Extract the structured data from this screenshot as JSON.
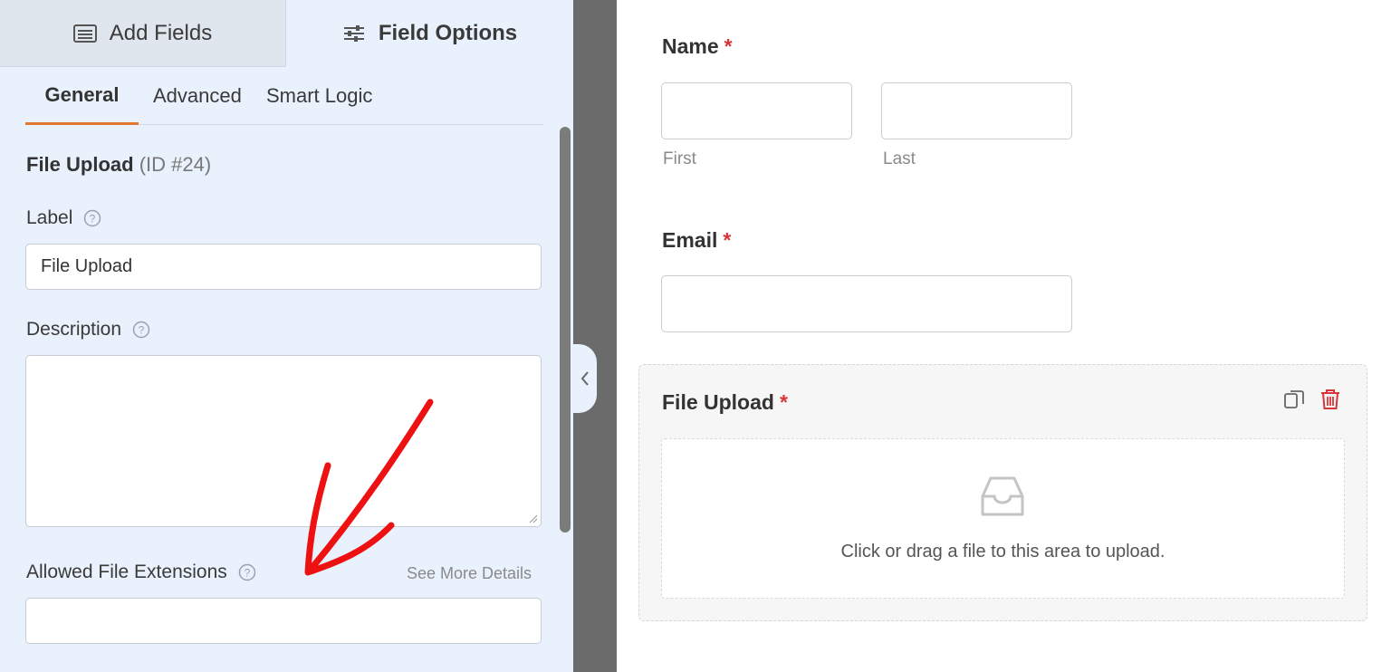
{
  "top_tabs": {
    "add_fields": "Add Fields",
    "field_options": "Field Options"
  },
  "sub_tabs": {
    "general": "General",
    "advanced": "Advanced",
    "smart_logic": "Smart Logic"
  },
  "field_options": {
    "field_name": "File Upload",
    "field_id": "(ID #24)",
    "label_label": "Label",
    "label_value": "File Upload",
    "description_label": "Description",
    "description_value": "",
    "extensions_label": "Allowed File Extensions",
    "extensions_value": "",
    "see_more": "See More Details"
  },
  "preview": {
    "name_label": "Name",
    "required_mark": "*",
    "first_sublabel": "First",
    "last_sublabel": "Last",
    "email_label": "Email",
    "upload_label": "File Upload",
    "upload_prompt": "Click or drag a file to this area to upload."
  },
  "colors": {
    "accent": "#e27730",
    "required": "#d63638",
    "annotation_arrow": "#ee1111",
    "panel_bg": "#e8f1fc"
  },
  "icons": {
    "add_fields": "list-icon",
    "field_options": "sliders-icon",
    "help": "question-circle-icon",
    "collapse": "chevron-left-icon",
    "duplicate": "duplicate-icon",
    "delete": "trash-icon",
    "upload": "inbox-tray-icon"
  }
}
